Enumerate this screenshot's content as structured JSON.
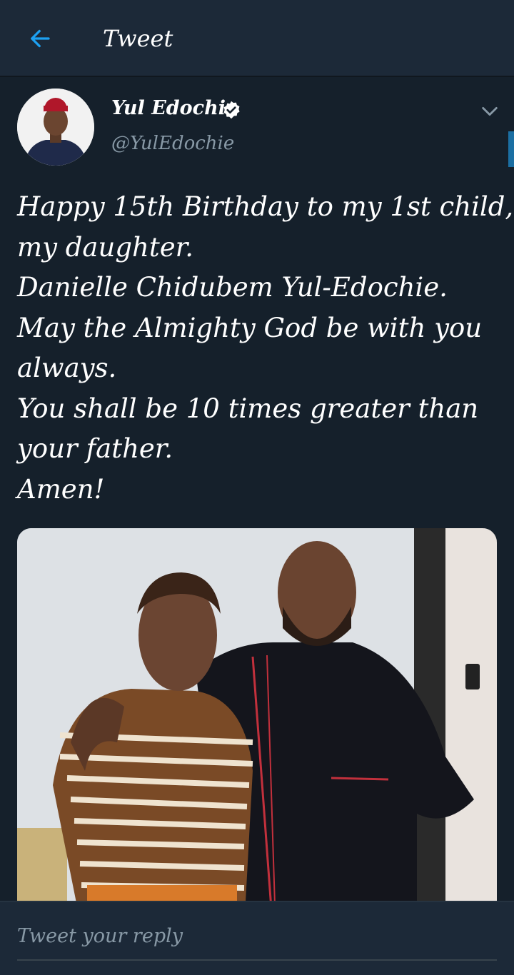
{
  "header": {
    "title": "Tweet",
    "back_icon": "arrow-left-icon",
    "accent": "#1da1f2"
  },
  "tweet": {
    "author_name": "Yul Edochie",
    "author_handle": "@YulEdochie",
    "verified": true,
    "text_lines": [
      "Happy 15th Birthday to my 1st child,",
      "my daughter.",
      "Danielle Chidubem Yul-Edochie.",
      "May the Almighty God be with you",
      "always.",
      "You shall be 10 times greater than",
      "your father.",
      "Amen!"
    ]
  },
  "reply": {
    "placeholder": "Tweet your reply"
  }
}
